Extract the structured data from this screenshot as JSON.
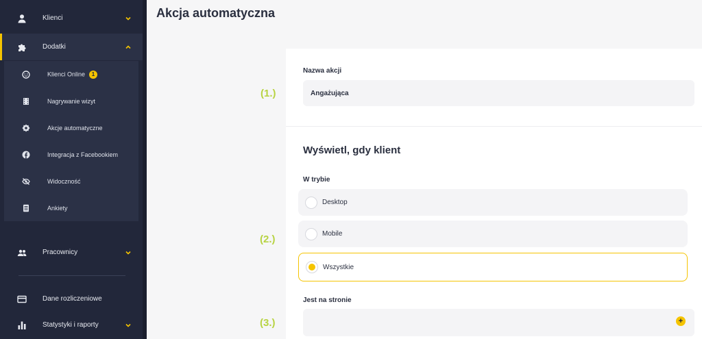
{
  "sidebar": {
    "items": [
      {
        "label": "Klienci",
        "icon": "user-icon",
        "expandable": true,
        "expanded": false
      },
      {
        "label": "Dodatki",
        "icon": "puzzle-icon",
        "expandable": true,
        "expanded": true
      },
      {
        "label": "Pracownicy",
        "icon": "users-icon",
        "expandable": true,
        "expanded": false
      },
      {
        "label": "Dane rozliczeniowe",
        "icon": "credit-card-icon",
        "expandable": false
      },
      {
        "label": "Statystyki i raporty",
        "icon": "bar-chart-icon",
        "expandable": true,
        "expanded": false
      }
    ],
    "submenu": [
      {
        "label": "Klienci Online",
        "icon": "smiley-icon",
        "badge": "1"
      },
      {
        "label": "Nagrywanie wizyt",
        "icon": "film-icon"
      },
      {
        "label": "Akcje automatyczne",
        "icon": "gear-icon"
      },
      {
        "label": "Integracja z Facebookiem",
        "icon": "facebook-icon"
      },
      {
        "label": "Widoczność",
        "icon": "eye-off-icon"
      },
      {
        "label": "Ankiety",
        "icon": "document-icon"
      }
    ]
  },
  "page": {
    "title": "Akcja automatyczna"
  },
  "steps": [
    "(1.)",
    "(2.)",
    "(3.)"
  ],
  "form": {
    "name_label": "Nazwa akcji",
    "name_value": "Angażująca",
    "section_title": "Wyświetl, gdy klient",
    "mode_label": "W trybie",
    "mode_options": [
      {
        "label": "Desktop",
        "selected": false
      },
      {
        "label": "Mobile",
        "selected": false
      },
      {
        "label": "Wszystkie",
        "selected": true
      }
    ],
    "page_label": "Jest na stronie",
    "page_value": "",
    "add_symbol": "+"
  },
  "colors": {
    "sidebar_bg": "#22273a",
    "accent": "#f5c400",
    "step_label": "#b7d342"
  }
}
